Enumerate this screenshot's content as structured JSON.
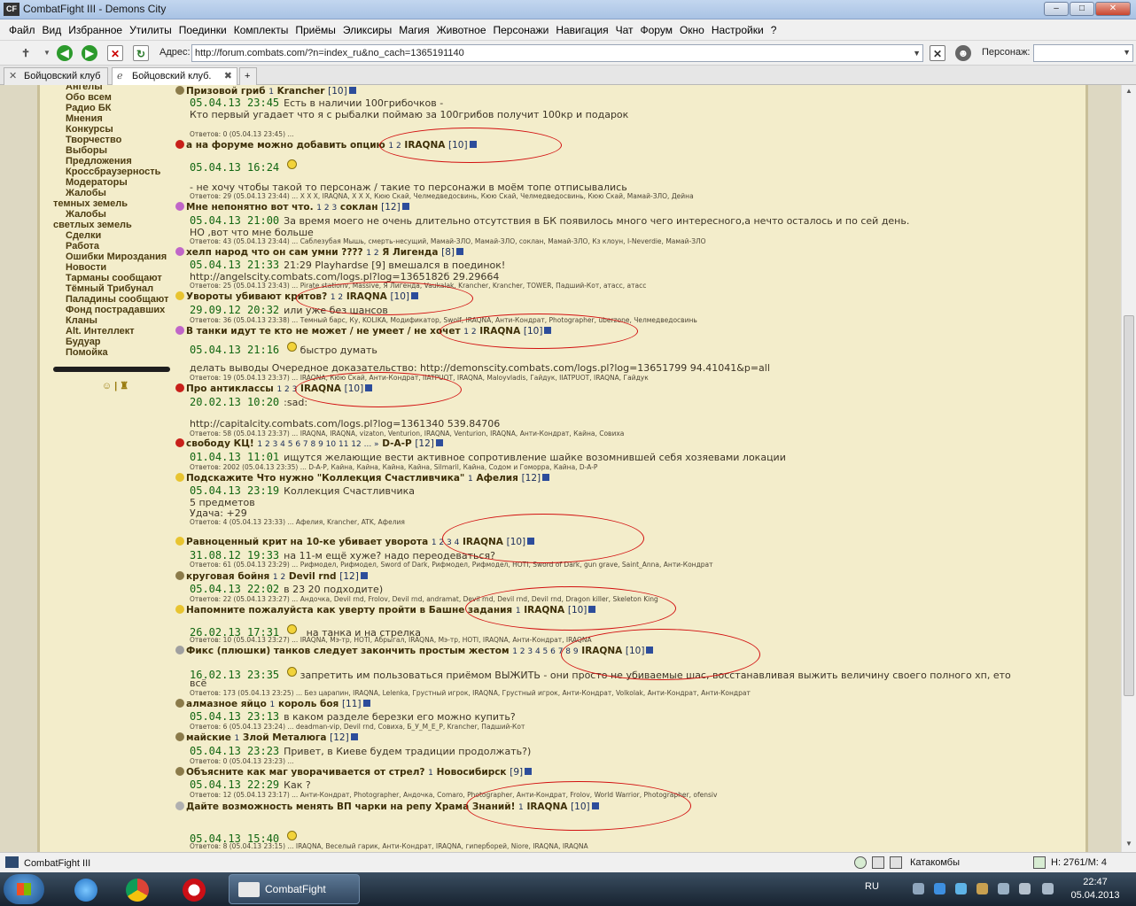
{
  "window": {
    "title": "CombatFight III - Demons City",
    "appicon": "CF",
    "buttons": [
      "–",
      "□",
      "✕"
    ]
  },
  "menu": [
    "Файл",
    "Вид",
    "Избранное",
    "Утилиты",
    "Поединки",
    "Комплекты",
    "Приёмы",
    "Эликсиры",
    "Магия",
    "Животное",
    "Персонажи",
    "Навигация",
    "Чат",
    "Форум",
    "Окно",
    "Настройки",
    "?"
  ],
  "toolbar": {
    "address_label": "Адрес:",
    "address": "http://forum.combats.com/?n=index_ru&no_cach=1365191140",
    "persona_label": "Персонаж:",
    "persona_value": ""
  },
  "tabs": [
    {
      "label": "Бойцовский клуб",
      "icon": "swords-icon"
    },
    {
      "label": "Бойцовский клуб.",
      "icon": "ie-icon",
      "close": "✖"
    },
    {
      "label": "+"
    }
  ],
  "sidebar": {
    "items": [
      "Ангелы",
      "Обо всем",
      "Радио БК",
      "Мнения",
      "Конкурсы",
      "Творчество",
      "Выборы",
      "Предложения",
      "Кроссбраузерность",
      "Модераторы",
      "Жалобы",
      "темных земель",
      "Жалобы",
      "светлых земель",
      "Сделки",
      "Работа",
      "Ошибки Мироздания",
      "Новости",
      "Тарманы сообщают",
      "Тёмный Трибунал",
      "Паладины сообщают",
      "Фонд пострадавших",
      "Кланы",
      "Alt. Интеллект",
      "Будуар",
      "Помойка"
    ],
    "smile_sep": "|"
  },
  "topics": [
    {
      "title": "Призовой гриб",
      "pages": "1",
      "nick": "Krancher",
      "level": "[10]",
      "date": "05.04.13 23:45",
      "msg": "Есть в наличии 100грибочков -",
      "msg2": "Кто первый угадает что я с рыбалки поймаю за 100грибов получит 100кр и подарок",
      "replies": "Ответов: 0    (05.04.13 23:45) ...",
      "icon": "#8b7b4a"
    },
    {
      "title": "а на форуме можно добавить опцию",
      "pages": "1 2",
      "nick": "IRAQNA",
      "level": "[10]",
      "date": "05.04.13 16:24",
      "msg": "",
      "msg2": "- не хочу чтобы такой то персонаж / такие то персонажи в моём топе отписывались",
      "replies": "Ответов: 29    (05.04.13 23:44) ... Х Х Х, IRAQNA, Х Х Х, Кюю Скай, Челмедведосвинь, Кюю Скай, Челмедведосвинь, Кюю Скай, Мамай-ЗЛО, Дейна",
      "icon": "#c8201a"
    },
    {
      "title": "Мне непонятно вот что.",
      "pages": "1 2 3",
      "nick": "соклан",
      "level": "[12]",
      "date": "05.04.13 21:00",
      "msg": "За время моего не очень длительно отсутствия в БК появилось много чего интересного,а нечто осталось и по сей день.",
      "msg2": "НО ,вот что мне больше",
      "replies": "Ответов: 43    (05.04.13 23:44) ... Саблезубая Мышь, смерть-несущий, Мамай-ЗЛО, Мамай-ЗЛО, соклан, Мамай-ЗЛО, Кз клоун, I-Neverdie, Мамай-ЗЛО",
      "icon": "#c066c8"
    },
    {
      "title": "хелп народ что он сам умни ????",
      "pages": "1 2",
      "nick": "Я Лигенда",
      "level": "[8]",
      "date": "05.04.13 21:33",
      "msg": "21:29 Playhardse [9] вмешался в поединок!",
      "msg2": "http://angelscity.combats.com/logs.pl?log=1365182б 29.29664",
      "replies": "Ответов: 25    (05.04.13 23:43) ... Pirate stationv, Massive, Я Лигенда, Vaukalak, Krancher, Krancher, TOWER, Падший-Кот, атасс, атасс",
      "icon": "#c066c8"
    },
    {
      "title": "Увороты убивают критов?",
      "pages": "1 2",
      "nick": "IRAQNA",
      "level": "[10]",
      "date": "29.09.12 20:32",
      "msg": "или уже без шансов",
      "msg2": "",
      "replies": "Ответов: 36    (05.04.13 23:38) ... Темный барс, Ку, KOLIKA, Модификатор, Swolf, IRAQNA, Анти-Кондрат, Photographer, uberzone, Челмедведосвинь",
      "icon": "#e8c430"
    },
    {
      "title": "В танки идут те кто не может / не умеет / не хочет",
      "pages": "1 2",
      "nick": "IRAQNA",
      "level": "[10]",
      "date": "05.04.13 21:16",
      "msg": "быстро думать",
      "msg2": "делать выводы Очередное доказательство: http://demonscity.combats.com/logs.pl?log=13651799 94.41041&p=all",
      "replies": "Ответов: 19    (05.04.13 23:37) ... IRAQNA, Кюю Скай, Анти-Кондрат, IIATPUOT, IRAQNA, Maloyvladis, Гайдук, IIATPUOT, IRAQNA, Гайдук",
      "icon": "#c066c8"
    },
    {
      "title": "Про антиклассы",
      "pages": "1 2 3",
      "nick": "IRAQNA",
      "level": "[10]",
      "date": "20.02.13 10:20",
      "msg": ":sad:",
      "msg2": "http://capitalcity.combats.com/logs.pl?log=1361340 539.84706",
      "replies": "Ответов: 58    (05.04.13 23:37) ... IRAQNA, IRAQNA, vizaton, Venturion, IRAQNA, Venturion, IRAQNA, Анти-Кондрат, Кайна, Совиха",
      "icon": "#c8201a"
    },
    {
      "title": "свободу КЦ!",
      "pages": "1 2 3 4 5 6 7 8 9 10 11 12 ... »",
      "nick": "D-A-P",
      "level": "[12]",
      "date": "01.04.13 11:01",
      "msg": "ищутся желающие вести активное сопротивление шайке возомнившей себя хозяевами локации",
      "msg2": "",
      "replies": "Ответов: 2002    (05.04.13 23:35) ... D-A-P, Кайна, Кайна, Кайна, Кайна, Silmaril, Кайна, Содом и Гоморра, Кайна, D-A-P",
      "icon": "#c8201a"
    },
    {
      "title": "Подскажите Что нужно \"Коллекция Счастливчика\"",
      "pages": "1",
      "nick": "Афелия",
      "level": "[12]",
      "date": "05.04.13 23:19",
      "msg": "Коллекция Счастливчика",
      "msg2": "5 предметов",
      "msg3": "Удача: +29",
      "replies": "Ответов: 4    (05.04.13 23:33) ... Афелия, Krancher, ATK, Афелия",
      "icon": "#e8c430"
    },
    {
      "title": "Равноценный крит на 10-ке убивает уворота",
      "pages": "1 2 3 4",
      "nick": "IRAQNA",
      "level": "[10]",
      "date": "31.08.12 19:33",
      "msg": "на 11-м ещё хуже? надо переодеваться?",
      "msg2": "",
      "replies": "Ответов: 61    (05.04.13 23:29) ... Рифмодел, Рифмодел, Sword of Dark, Рифмодел, Рифмодел, HOTI, Sword of Dark, gun grave, Saint_Anna, Анти-Кондрат",
      "icon": "#e8c430"
    },
    {
      "title": "круговая бойня",
      "pages": "1 2",
      "nick": "Devil rnd",
      "level": "[12]",
      "date": "05.04.13 22:02",
      "msg": "в 23 20 подходите)",
      "msg2": "",
      "replies": "Ответов: 22    (05.04.13 23:27) ... Андочка, Devil rnd, Frolov, Devil rnd, andramat, Devil rnd, Devil rnd, Devil rnd, Dragon killer, Skeleton King",
      "icon": "#8b7b4a"
    },
    {
      "title": "Напомните пожалуйста как уверту пройти в Башне задания",
      "pages": "1",
      "nick": "IRAQNA",
      "level": "[10]",
      "date": "26.02.13 17:31",
      "msg": "на танка и на стрелка",
      "msg2": "",
      "replies": "Ответов: 10    (05.04.13 23:27) ... IRAQNA, Мэ-тр, HOTI, Абрыгал, IRAQNA, Мэ-тр, HOTI, IRAQNA, Анти-Кондрат, IRAQNA",
      "icon": "#e8c430"
    },
    {
      "title": "Фикс (плюшки) танков следует закончить простым жестом",
      "pages": "1 2 3 4 5 6 7 8 9",
      "nick": "IRAQNA",
      "level": "[10]",
      "date": "16.02.13 23:35",
      "msg": "запретить им пользоваться приёмом ВЫЖИТЬ - они просто не убиваемые шас, восстанавливая выжить величину своего полного хп, ето",
      "msg2": "всё",
      "replies": "Ответов: 173    (05.04.13 23:25) ... Без царапин, IRAQNA, Lelenka, Грустный игрок, IRAQNA, Грустный игрок, Анти-Кондрат, Volkolak, Анти-Кондрат, Анти-Кондрат",
      "icon": "#a0a0a0"
    },
    {
      "title": "алмазное яйцо",
      "pages": "1",
      "nick": "король боя",
      "level": "[11]",
      "date": "05.04.13 23:13",
      "msg": "в каком разделе березки его можно купить?",
      "msg2": "",
      "replies": "Ответов: 6    (05.04.13 23:24) ... deadman-vip, Devil rnd, Совиха, Б_У_М_Е_Р, Krancher, Падший-Кот",
      "icon": "#8b7b4a"
    },
    {
      "title": "майские",
      "pages": "1",
      "nick": "Злой Металюга",
      "level": "[12]",
      "date": "05.04.13 23:23",
      "msg": "Привет, в Киеве будем традиции продолжать?)",
      "msg2": "",
      "replies": "Ответов: 0    (05.04.13 23:23) ...",
      "icon": "#8b7b4a"
    },
    {
      "title": "Объясните как маг уворачивается от стрел?",
      "pages": "1",
      "nick": "Новосибирск",
      "level": "[9]",
      "date": "05.04.13 22:29",
      "msg": "Как ?",
      "msg2": "",
      "replies": "Ответов: 12    (05.04.13 23:17) ... Анти-Кондрат, Photographer, Андочка, Comaro, Photographer, Анти-Кондрат, Frolov, World Warrior, Photographer, ofensiv",
      "icon": "#8b7b4a"
    },
    {
      "title": "Дайте возможность менять ВП чарки на репу Храма Знаний!",
      "pages": "1",
      "nick": "IRAQNA",
      "level": "[10]",
      "date": "05.04.13 15:40",
      "msg": "",
      "msg2": "",
      "replies": "Ответов: 8    (05.04.13 23:15) ... IRAQNA, Веселый гарик, Анти-Кондрат, IRAQNA, гиперборей, Niore, IRAQNA, IRAQNA",
      "icon": "#b0b0b0"
    }
  ],
  "statusbar": {
    "app": "CombatFight III",
    "location": "Катакомбы",
    "hm": "H: 2761/M: 4"
  },
  "taskbar": {
    "app_label": "CombatFight",
    "lang": "RU",
    "time": "22:47",
    "date": "05.04.2013"
  }
}
